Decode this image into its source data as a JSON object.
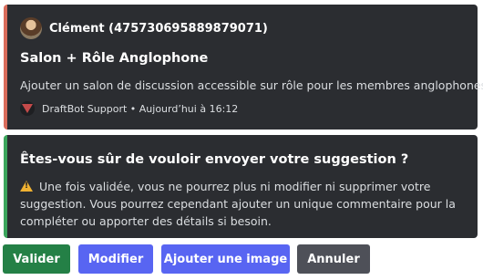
{
  "embed1": {
    "author": "Clément (475730695889879071)",
    "title": "Salon + Rôle Anglophone",
    "description": "Ajouter un salon de discussion accessible sur rôle pour les membres anglophones.",
    "footer": "DraftBot Support • Aujourd’hui à 16:12"
  },
  "embed2": {
    "title": "Êtes-vous sûr de vouloir envoyer votre suggestion ?",
    "warning_icon": "warning-icon",
    "description": "Une fois validée, vous ne pourrez plus ni modifier ni supprimer votre suggestion. Vous pourrez cependant ajouter un unique commentaire pour la compléter ou apporter des détails si besoin."
  },
  "buttons": {
    "validate": "Valider",
    "modify": "Modifier",
    "add_image": "Ajouter une image",
    "cancel": "Annuler"
  },
  "colors": {
    "embed1_accent": "#d96c5b",
    "embed2_accent": "#3ba55c",
    "success": "#248046",
    "primary": "#5865f2",
    "secondary": "#4e5058"
  }
}
